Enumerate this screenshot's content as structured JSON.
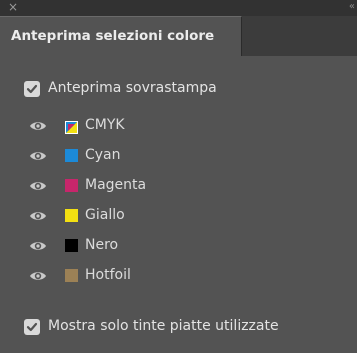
{
  "window": {
    "close_glyph": "×",
    "collapse_glyph": "«"
  },
  "panel": {
    "tab_title": "Anteprima selezioni colore"
  },
  "overprint": {
    "label": "Anteprima sovrastampa",
    "checked": true
  },
  "separations": [
    {
      "name": "CMYK",
      "visible": true,
      "swatch": "cmyk-composite"
    },
    {
      "name": "Cyan",
      "visible": true,
      "swatch": "#1c8ad8"
    },
    {
      "name": "Magenta",
      "visible": true,
      "swatch": "#c7266b"
    },
    {
      "name": "Giallo",
      "visible": true,
      "swatch": "#f3e012"
    },
    {
      "name": "Nero",
      "visible": true,
      "swatch": "#000000"
    },
    {
      "name": "Hotfoil",
      "visible": true,
      "swatch": "#9c8156"
    }
  ],
  "spot_only": {
    "label": "Mostra solo tinte piatte utilizzate",
    "checked": true
  },
  "colors": {
    "panel_bg": "#535353",
    "tab_bar_bg": "#3c3c3c",
    "title_bar_bg": "#323232",
    "checkbox_bg": "#d9d9d9",
    "check_mark": "#535353"
  }
}
